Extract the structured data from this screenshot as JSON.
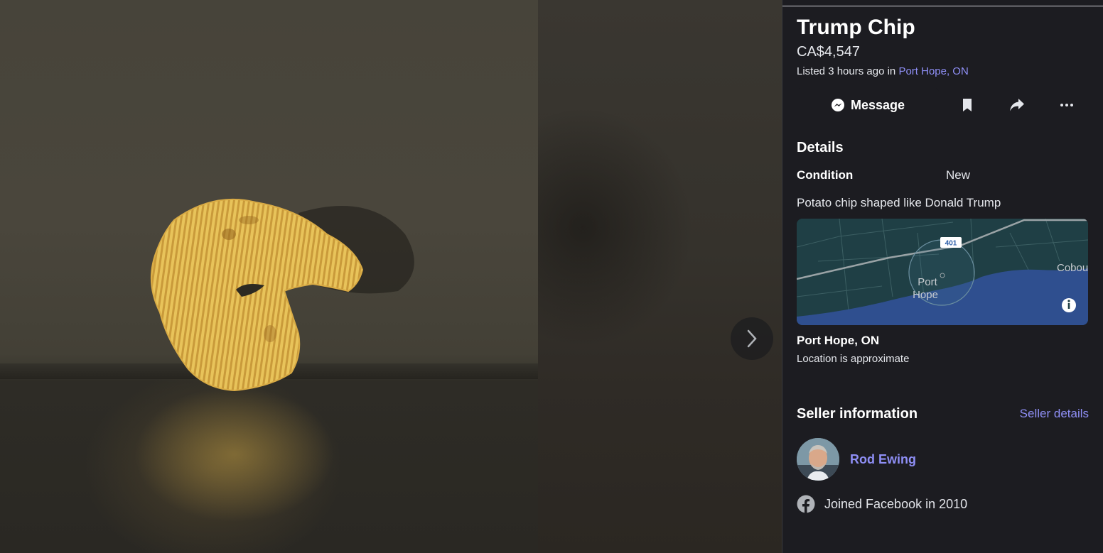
{
  "listing": {
    "title": "Trump Chip",
    "price": "CA$4,547",
    "listed_prefix": "Listed 3 hours ago in ",
    "listed_location": "Port Hope, ON"
  },
  "actions": {
    "message_label": "Message",
    "save_icon": "bookmark-icon",
    "share_icon": "share-icon",
    "more_icon": "more-icon"
  },
  "details": {
    "heading": "Details",
    "condition_label": "Condition",
    "condition_value": "New",
    "description": "Potato chip shaped like Donald Trump"
  },
  "map": {
    "town_label_1": "Port",
    "town_label_2": "Hope",
    "neighbor_label": "Cobou",
    "highway_label": "401"
  },
  "location": {
    "name": "Port Hope, ON",
    "note": "Location is approximate"
  },
  "seller": {
    "heading": "Seller information",
    "details_link": "Seller details",
    "name": "Rod Ewing",
    "joined": "Joined Facebook in 2010"
  },
  "colors": {
    "panel_bg": "#1c1c21",
    "link": "#8f8ff6",
    "text": "#e4e6eb",
    "chip": "#e8c35a",
    "water": "#2f4f8f"
  }
}
